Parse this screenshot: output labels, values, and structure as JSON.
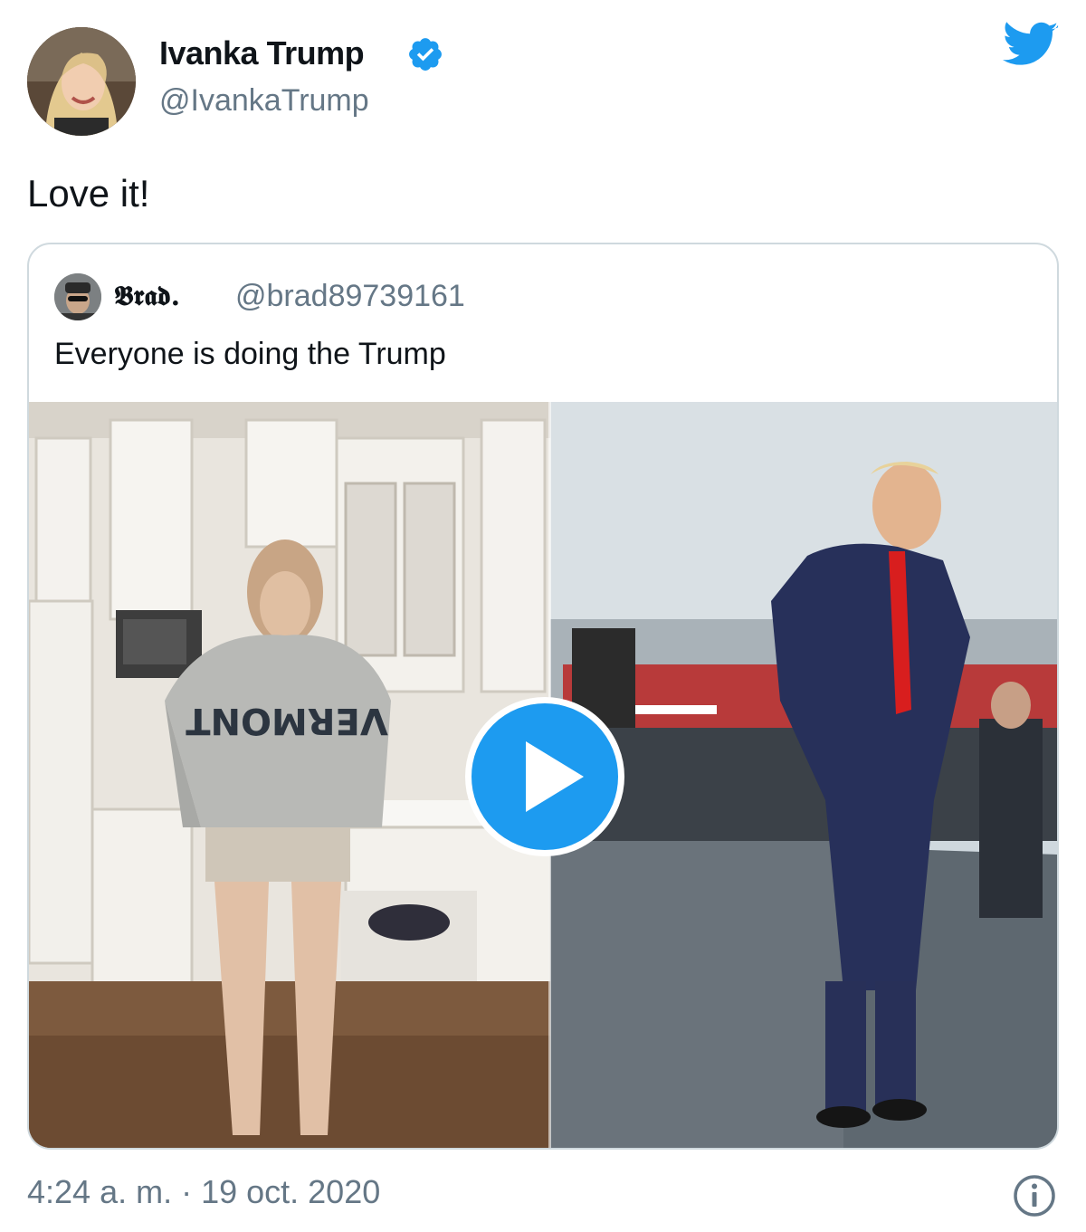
{
  "author": {
    "display_name": "Ivanka Trump",
    "handle": "@IvankaTrump",
    "avatar_icon": "user-avatar",
    "verified_icon": "verified-badge-icon"
  },
  "tweet": {
    "text": "Love it!",
    "timestamp": "4:24 a. m. · 19 oct. 2020"
  },
  "quoted_tweet": {
    "display_name": "𝕭𝖗𝖆𝖉.",
    "handle": "@brad89739161",
    "text": "Everyone is doing the Trump",
    "media_type": "video",
    "play_icon": "play-icon"
  },
  "colors": {
    "brand_blue": "#1d9bf0",
    "text_primary": "#0f1419",
    "text_secondary": "#657786",
    "border": "#cfd9de"
  },
  "icons": [
    "twitter-bird-icon",
    "verified-badge-icon",
    "play-icon",
    "info-icon"
  ]
}
